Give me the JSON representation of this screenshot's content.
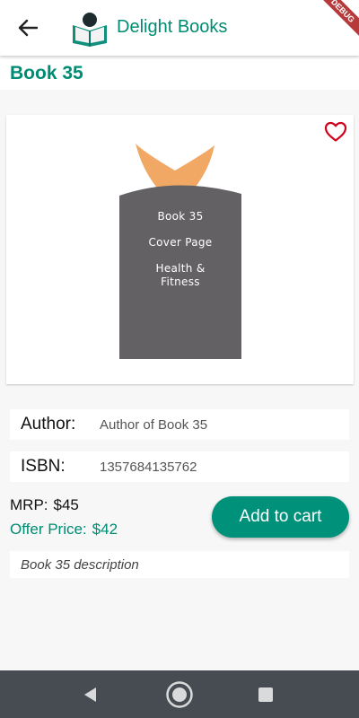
{
  "app": {
    "title": "Delight Books",
    "debug_badge": "DEBUG",
    "back_icon": "arrow-left-icon",
    "logo_icon": "reader-book-logo"
  },
  "book": {
    "title": "Book 35",
    "favorite_icon": "heart-outline-icon",
    "cover": {
      "line1": "Book 35",
      "line2": "Cover Page",
      "line3": "Health &",
      "line4": "Fitness"
    },
    "author_label": "Author:",
    "author": "Author of Book 35",
    "isbn_label": "ISBN:",
    "isbn": "1357684135762",
    "mrp_label": "MRP:",
    "mrp": "$45",
    "offer_label": "Offer Price:",
    "offer_price": "$42",
    "add_to_cart": "Add to cart",
    "description": "Book 35 description"
  },
  "colors": {
    "brand": "#008b73",
    "cover_body": "#636164",
    "cover_accent": "#f2a865",
    "favorite": "#d0021b",
    "nav_bar": "#474c52"
  },
  "navigation": {
    "back": "triangle-back-icon",
    "home": "circle-home-icon",
    "recents": "square-recents-icon"
  }
}
